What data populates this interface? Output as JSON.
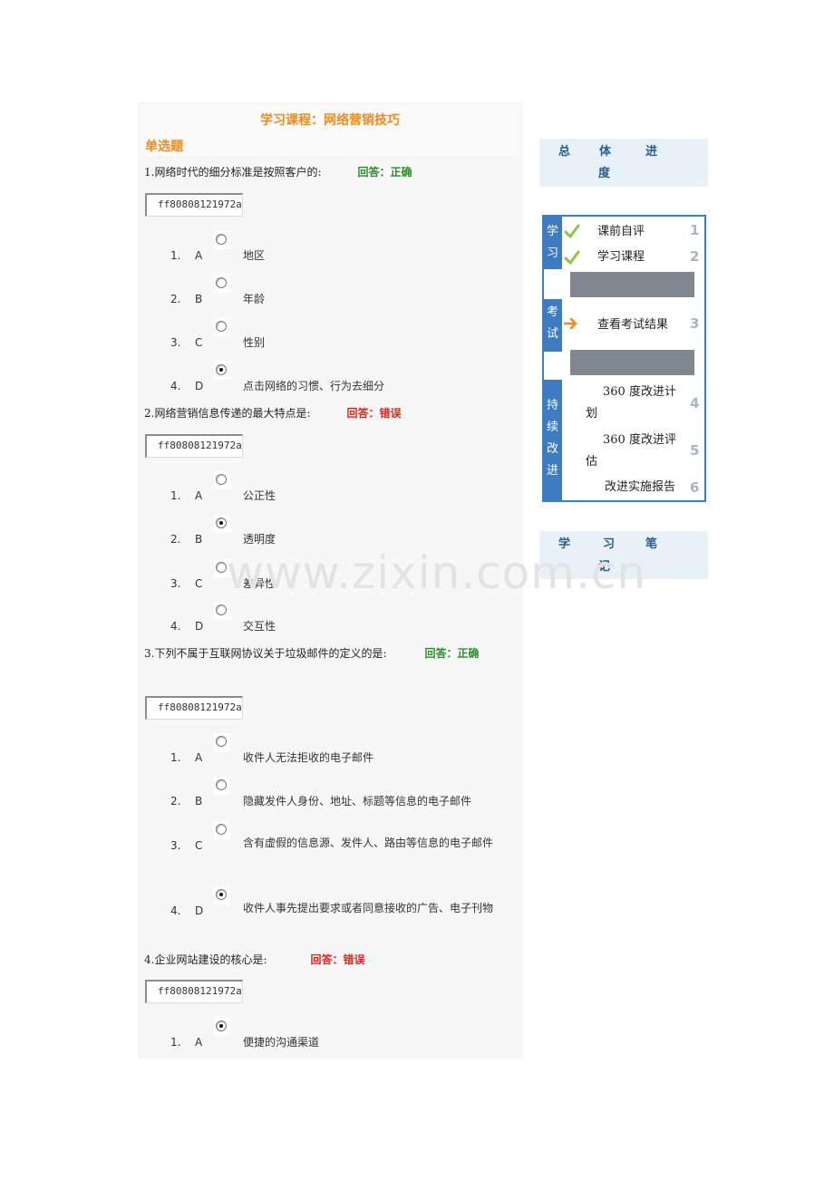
{
  "course": {
    "title": "学习课程：网络营销技巧",
    "section_label": "单选题"
  },
  "questions": [
    {
      "prompt": "1.网络时代的细分标准是按照客户的:",
      "answer": "回答：正确",
      "answer_status": "correct",
      "code": "ff80808121972a",
      "options": [
        {
          "num": "1.",
          "letter": "A",
          "text": "地区",
          "selected": false
        },
        {
          "num": "2.",
          "letter": "B",
          "text": "年龄",
          "selected": false
        },
        {
          "num": "3.",
          "letter": "C",
          "text": "性别",
          "selected": false
        },
        {
          "num": "4.",
          "letter": "D",
          "text": "点击网络的习惯、行为去细分",
          "selected": true
        }
      ]
    },
    {
      "prompt": "2.网络营销信息传递的最大特点是:",
      "answer": "回答：错误",
      "answer_status": "wrong",
      "code": "ff80808121972a",
      "options": [
        {
          "num": "1.",
          "letter": "A",
          "text": "公正性",
          "selected": false
        },
        {
          "num": "2.",
          "letter": "B",
          "text": "透明度",
          "selected": true
        },
        {
          "num": "3.",
          "letter": "C",
          "text": "差异性",
          "selected": false
        },
        {
          "num": "4.",
          "letter": "D",
          "text": "交互性",
          "selected": false
        }
      ]
    },
    {
      "prompt": "3.下列不属于互联网协议关于垃圾邮件的定义的是:",
      "answer": "回答：正确",
      "answer_status": "correct",
      "code": "ff80808121972a",
      "options": [
        {
          "num": "1.",
          "letter": "A",
          "text": "收件人无法拒收的电子邮件",
          "selected": false
        },
        {
          "num": "2.",
          "letter": "B",
          "text": "隐藏发件人身份、地址、标题等信息的电子邮件",
          "selected": false
        },
        {
          "num": "3.",
          "letter": "C",
          "text": "含有虚假的信息源、发件人、路由等信息的电子邮件",
          "selected": false
        },
        {
          "num": "4.",
          "letter": "D",
          "text": "收件人事先提出要求或者同意接收的广告、电子刊物",
          "selected": true
        }
      ]
    },
    {
      "prompt": "4.企业网站建设的核心是:",
      "answer": "回答：错误",
      "answer_status": "wrong",
      "code": "ff80808121972a",
      "options": [
        {
          "num": "1.",
          "letter": "A",
          "text": "便捷的沟通渠道",
          "selected": true
        }
      ]
    }
  ],
  "sidebar": {
    "progress": {
      "label_1": "总",
      "label_2": "体",
      "label_3": "进",
      "label_4": "度"
    },
    "sections": [
      {
        "chars": [
          "学",
          "习"
        ]
      },
      {
        "chars": [
          "考",
          "试"
        ]
      },
      {
        "chars": [
          "持",
          "续",
          "改",
          "进"
        ]
      }
    ],
    "steps": [
      {
        "label": "课前自评",
        "number": "1",
        "status": "done",
        "icon": "check-icon"
      },
      {
        "label": "学习课程",
        "number": "2",
        "status": "done",
        "icon": "check-icon"
      },
      {
        "label": "查看考试结果",
        "number": "3",
        "status": "current",
        "icon": "arrow-right-icon"
      },
      {
        "label_line1": "360 度改进计",
        "label_line2": "划",
        "number": "4"
      },
      {
        "label_line1": "360 度改进评",
        "label_line2": "估",
        "number": "5"
      },
      {
        "label": "改进实施报告",
        "number": "6"
      }
    ],
    "notes": {
      "label_1": "学",
      "label_2": "习",
      "label_3": "笔",
      "label_4": "记"
    }
  },
  "watermark": "www.zixin.com.cn",
  "colors": {
    "accent_orange": "#f08a1c",
    "correct_green": "#2e8b2e",
    "wrong_red": "#e0261b",
    "sidebar_blue": "#3d7cc0",
    "box_bg": "#e8f0f8"
  }
}
